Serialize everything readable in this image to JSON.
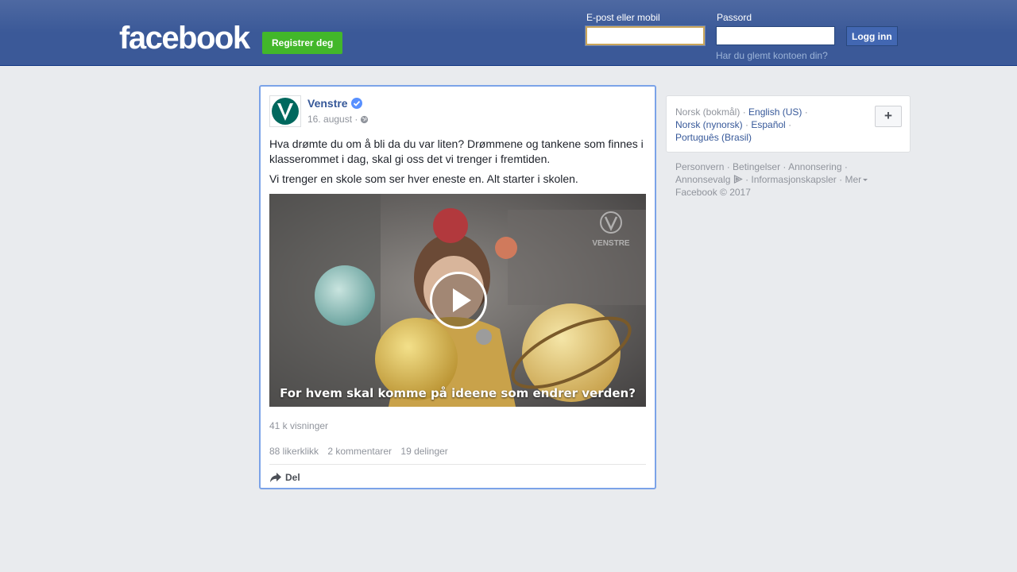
{
  "header": {
    "logo": "facebook",
    "register_label": "Registrer deg",
    "email_label": "E-post eller mobil",
    "password_label": "Passord",
    "login_label": "Logg inn",
    "forgot_label": "Har du glemt kontoen din?"
  },
  "post": {
    "page_name": "Venstre",
    "date": "16. august ·",
    "text_1": "Hva drømte du om å bli da du var liten? Drømmene og tankene som finnes i klasserommet i dag, skal gi oss det vi trenger i fremtiden.",
    "text_2": "Vi trenger en skole som ser hver eneste en. Alt starter i skolen.",
    "video_caption": "For hvem skal komme på ideene som endrer verden?",
    "video_watermark": "VENSTRE",
    "views": "41 k visninger",
    "likes": "88 likerklikk",
    "comments": "2 kommentarer",
    "shares": "19 delinger",
    "share_label": "Del"
  },
  "languages": {
    "current": "Norsk (bokmål)",
    "items": [
      "English (US)",
      "Norsk (nynorsk)",
      "Español",
      "Português (Brasil)"
    ],
    "plus": "+"
  },
  "footer": {
    "links": [
      "Personvern",
      "Betingelser",
      "Annonsering",
      "Annonsevalg",
      "Informasjonskapsler",
      "Mer"
    ],
    "copyright": "Facebook © 2017"
  },
  "colors": {
    "header_blue": "#3b5998",
    "register_green": "#42b72a",
    "link_blue": "#365899",
    "venstre_green": "#00685e"
  }
}
